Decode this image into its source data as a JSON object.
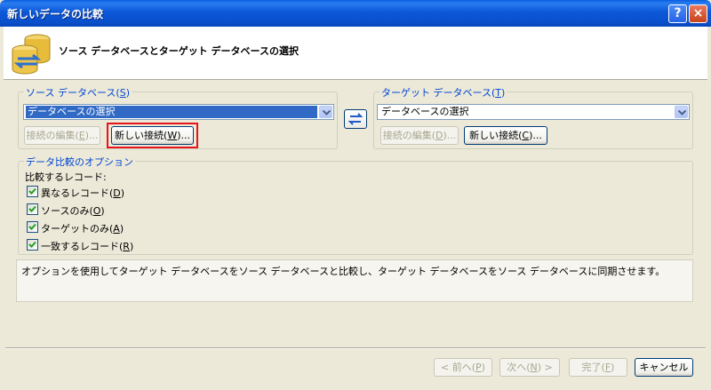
{
  "window": {
    "title": "新しいデータの比較",
    "help_label": "?",
    "close_label": "×"
  },
  "header": {
    "title": "ソース データベースとターゲット データベースの選択",
    "icon": "database-compare-icon"
  },
  "source": {
    "legend": "ソース データベース",
    "legend_key": "S",
    "selected": "データベースの選択",
    "edit_label": "接続の編集",
    "edit_key": "E",
    "new_label": "新しい接続",
    "new_key": "W"
  },
  "target": {
    "legend": "ターゲット データベース",
    "legend_key": "T",
    "selected": "データベースの選択",
    "edit_label": "接続の編集",
    "edit_key": "D",
    "new_label": "新しい接続",
    "new_key": "C"
  },
  "options": {
    "legend": "データ比較のオプション",
    "compare_label": "比較するレコード:",
    "checkboxes": [
      {
        "label": "異なるレコード",
        "key": "D",
        "checked": true
      },
      {
        "label": "ソースのみ",
        "key": "O",
        "checked": true
      },
      {
        "label": "ターゲットのみ",
        "key": "A",
        "checked": true
      },
      {
        "label": "一致するレコード",
        "key": "R",
        "checked": true
      }
    ]
  },
  "description": "オプションを使用してターゲット データベースをソース データベースと比較し、ターゲット データベースをソース データベースに同期させます。",
  "footer": {
    "prev_label": "< 前へ",
    "prev_key": "P",
    "next_label": "次へ",
    "next_key": "N",
    "next_suffix": " >",
    "finish_label": "完了",
    "finish_key": "F",
    "cancel_label": "キャンセル"
  },
  "colors": {
    "title_bar": "#0A4FCB",
    "legend_text": "#0046D5",
    "highlight": "#E8141B",
    "selection": "#316AC5"
  }
}
